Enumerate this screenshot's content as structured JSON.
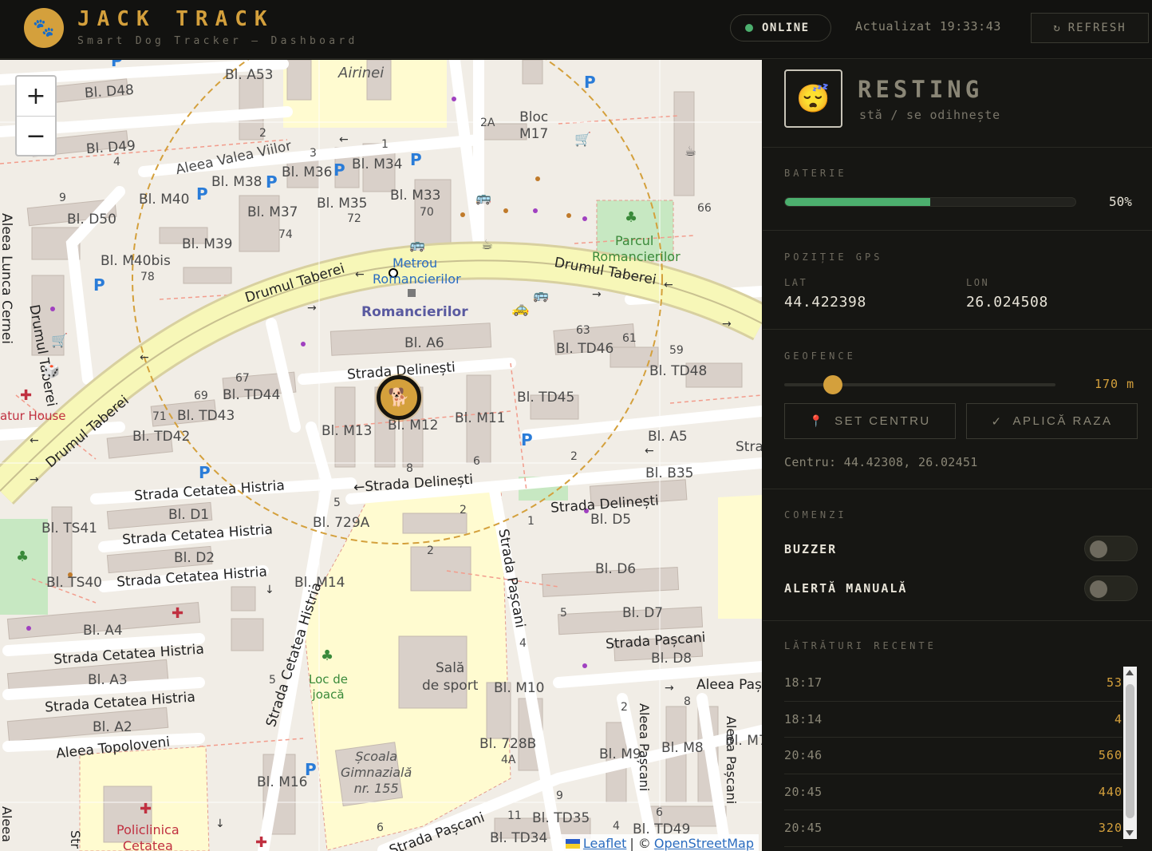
{
  "header": {
    "brand_title": "JACK TRACK",
    "brand_subtitle": "Smart Dog Tracker — Dashboard",
    "logo_icon": "paw-icon",
    "online_label": "ONLINE",
    "updated_label": "Actualizat 19:33:43",
    "refresh_label": "REFRESH"
  },
  "map": {
    "zoom_in": "+",
    "zoom_out": "−",
    "attribution_leaflet": "Leaflet",
    "attribution_sep": " | © ",
    "attribution_osm": "OpenStreetMap",
    "labels": {
      "airinei": "Airinei",
      "metrou": "Metrou",
      "romancierilor_station": "Romancierilor",
      "romancierilor": "Romancierilor",
      "drumul_taberei_1": "Drumul Taberei",
      "drumul_taberei_2": "Drumul Taberei",
      "drumul_taberei_3": "Drumul Taberei",
      "drumul_taberei_4": "Drumul Taberei",
      "aleea_valea_viilor": "Aleea Valea Viilor",
      "strada_delinesti_1": "Strada Delinești",
      "strada_delinesti_2": "←Strada Delinești",
      "strada_delinesti_3": "Strada Delinești",
      "strada_cetatea_histria_1": "Strada Cetatea Histria",
      "strada_cetatea_histria_2": "Strada Cetatea Histria",
      "strada_cetatea_histria_3": "Strada Cetatea Histria",
      "strada_cetatea_histria_4": "Strada Cetatea Histria",
      "strada_cetatea_histria_5": "Strada Cetatea Histria",
      "strada_cetatea_histria_6": "Strada Cetatea Histria",
      "strada_pascani_1": "Strada Pașcani",
      "strada_pascani_2": "Strada Pașcani",
      "strada_pascani_3": "Strada Pașcani",
      "aleea_pascani_1": "Aleea Pașcani",
      "aleea_pascani_2": "Aleea Pașcani",
      "aleea_pascani_3": "Aleea Paș",
      "aleea_topoloveni": "Aleea Topoloveni",
      "drumul_taberei_v": "Drumul Taberei",
      "parcul": "Parcul",
      "parcul_2": "Romancierilor",
      "sala": "Sală",
      "sala_2": "de sport",
      "loc": "Loc de",
      "loc_2": "joacă",
      "scoala": "Școala",
      "scoala_2": "Gimnazială",
      "scoala_3": "nr. 155",
      "policlinica": "Policlinica",
      "policlinica_2": "Cetatea",
      "natur_house": "atur House",
      "bloc": "Bloc",
      "bloc_2": "M17",
      "lunca_cernei": "Aleea Lunca Cernei",
      "bl_a53": "Bl. A53",
      "bl_d48": "Bl. D48",
      "bl_d49": "Bl. D49",
      "bl_d50": "Bl. D50",
      "bl_m34": "Bl. M34",
      "bl_m36": "Bl. M36",
      "bl_m38": "Bl. M38",
      "bl_m40": "Bl. M40",
      "bl_m35": "Bl. M35",
      "bl_m33": "Bl. M33",
      "bl_m37": "Bl. M37",
      "bl_m39": "Bl. M39",
      "bl_m40bis": "Bl. M40bis",
      "bl_a6": "Bl. A6",
      "bl_td46": "Bl. TD46",
      "bl_td48": "Bl. TD48",
      "bl_td44": "Bl. TD44",
      "bl_td43": "Bl. TD43",
      "bl_td42": "Bl. TD42",
      "bl_td45": "Bl. TD45",
      "bl_m13": "Bl. M13",
      "bl_m12": "Bl. M12",
      "bl_m11": "Bl. M11",
      "bl_a5": "Bl. A5",
      "bl_b35": "Bl. B35",
      "bl_d1": "Bl. D1",
      "bl_d2": "Bl. D2",
      "bl_ts41": "Bl. TS41",
      "bl_ts40": "Bl. TS40",
      "bl_729a": "Bl. 729A",
      "bl_d5": "Bl. D5",
      "bl_d6": "Bl. D6",
      "bl_d7": "Bl. D7",
      "bl_d8": "Bl. D8",
      "bl_m14": "Bl. M14",
      "bl_a4": "Bl. A4",
      "bl_a3": "Bl. A3",
      "bl_a2": "Bl. A2",
      "bl_m10": "Bl. M10",
      "bl_728b": "Bl. 728B",
      "bl_m9": "Bl. M9",
      "bl_m8": "Bl. M8",
      "bl_m7": "Bl. M7",
      "bl_m16": "Bl. M16",
      "bl_td35": "Bl. TD35",
      "bl_td49": "Bl. TD49",
      "bl_td34": "Bl. TD34",
      "stra": "Stra",
      "stra_2": "Str",
      "aleea_left": "Aleea",
      "n_2": "2",
      "n_2a": "2A",
      "n_3": "3",
      "n_1": "1",
      "n_4": "4",
      "n_9": "9",
      "n_72": "72",
      "n_70": "70",
      "n_74": "74",
      "n_78": "78",
      "n_66": "66",
      "n_63": "63",
      "n_61": "61",
      "n_59": "59",
      "n_67": "67",
      "n_69": "69",
      "n_71": "71",
      "n_8": "8",
      "n_6": "6",
      "n_2b": "2",
      "n_5": "5",
      "n_2c": "2",
      "n_2d": "2",
      "n_5b": "5",
      "n_4b": "4",
      "n_5c": "5",
      "n_2e": "2",
      "n_8b": "8",
      "n_4a": "4A",
      "n_9b": "9",
      "n_11": "11",
      "n_4c": "4",
      "n_6b": "6",
      "n_6c": "6",
      "n_1b": "1"
    }
  },
  "status": {
    "icon": "sleeping-face-icon",
    "emoji": "😴",
    "title": "RESTING",
    "subtitle": "stă / se odihnește"
  },
  "battery": {
    "label": "BATERIE",
    "percent": 50,
    "value_text": "50%"
  },
  "gps": {
    "label": "POZIȚIE GPS",
    "lat_key": "LAT",
    "lat_value": "44.422398",
    "lon_key": "LON",
    "lon_value": "26.024508"
  },
  "geofence": {
    "label": "GEOFENCE",
    "radius_text": "170 m",
    "slider_fraction": 0.18,
    "set_center_label": "SET CENTRU",
    "apply_radius_label": "APLICĂ RAZA",
    "center_text": "Centru: 44.42308, 26.02451"
  },
  "commands": {
    "label": "COMENZI",
    "buzzer_label": "BUZZER",
    "buzzer_on": false,
    "alert_label": "ALERTĂ MANUALĂ",
    "alert_on": false
  },
  "barks": {
    "label": "LĂTRĂTURI RECENTE",
    "rows": [
      {
        "time": "18:17",
        "value": "53"
      },
      {
        "time": "18:14",
        "value": "4"
      },
      {
        "time": "20:46",
        "value": "560"
      },
      {
        "time": "20:45",
        "value": "440"
      },
      {
        "time": "20:45",
        "value": "320"
      }
    ]
  },
  "colors": {
    "accent": "#d4a03c",
    "online": "#4caf6e",
    "battery": "#4caf6e"
  }
}
